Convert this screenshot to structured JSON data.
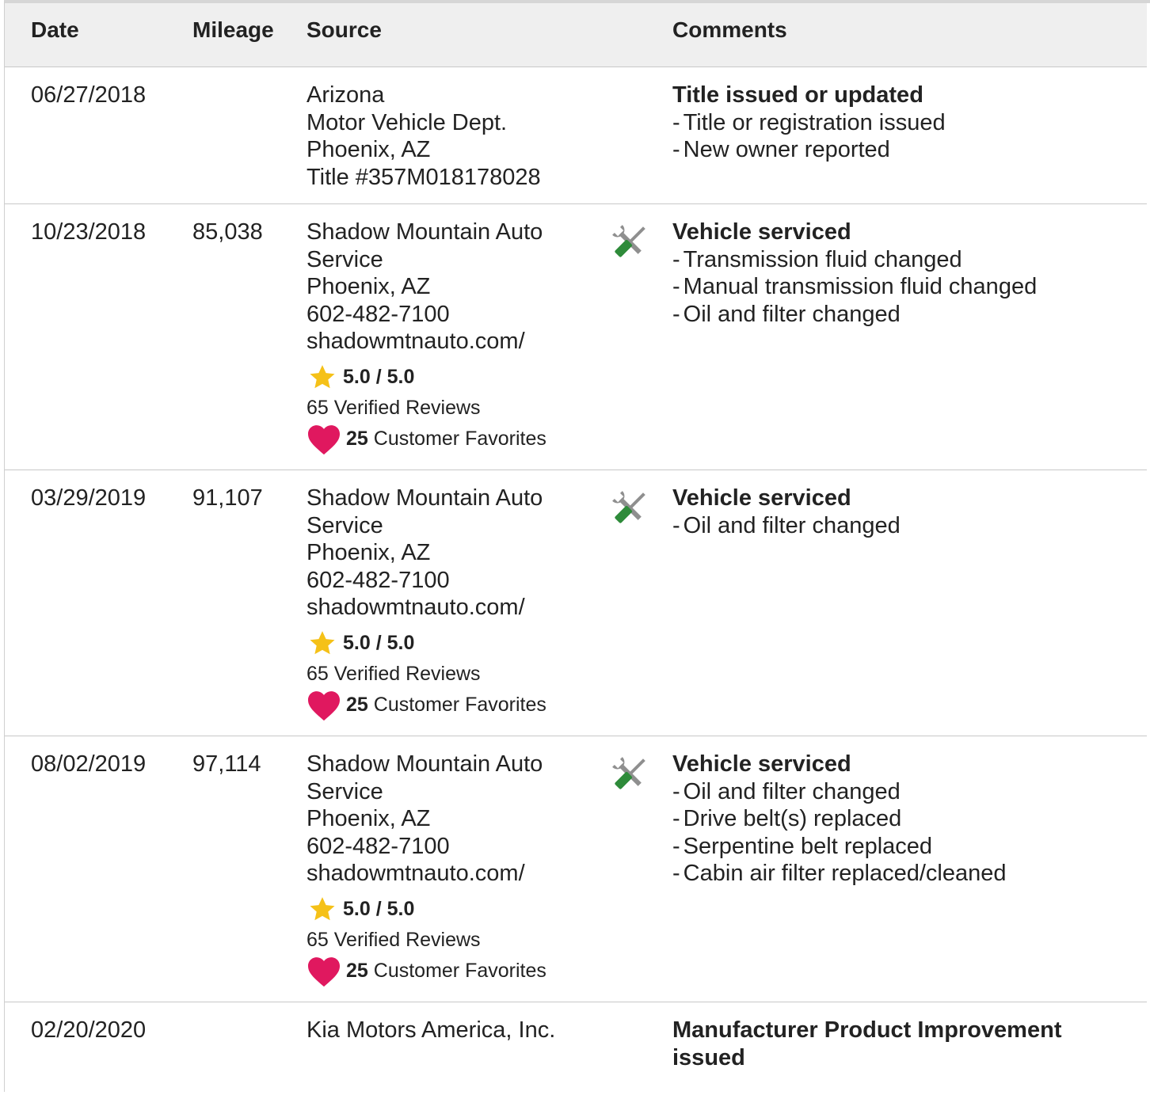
{
  "table": {
    "headers": {
      "date": "Date",
      "mileage": "Mileage",
      "source": "Source",
      "comments": "Comments"
    },
    "rows": [
      {
        "date": "06/27/2018",
        "mileage": "",
        "source_lines": [
          "Arizona",
          "Motor Vehicle Dept.",
          "Phoenix, AZ",
          "Title #357M018178028"
        ],
        "comment_title": "Title issued or updated",
        "comment_items": [
          "Title or registration issued",
          "New owner reported"
        ]
      },
      {
        "date": "10/23/2018",
        "mileage": "85,038",
        "source_lines": [
          "Shadow Mountain Auto",
          "Service",
          "Phoenix, AZ",
          "602-482-7100",
          "shadowmtnauto.com/"
        ],
        "rating": "5.0 / 5.0",
        "reviews": "65 Verified Reviews",
        "favorites_count": "25",
        "favorites_label": "Customer Favorites",
        "service_icon": "wrench-screwdriver-icon",
        "comment_title": "Vehicle serviced",
        "comment_items": [
          "Transmission fluid changed",
          "Manual transmission fluid changed",
          "Oil and filter changed"
        ]
      },
      {
        "date": "03/29/2019",
        "mileage": "91,107",
        "source_lines": [
          "Shadow Mountain Auto",
          "Service",
          "Phoenix, AZ",
          "602-482-7100",
          "shadowmtnauto.com/"
        ],
        "rating": "5.0 / 5.0",
        "reviews": "65 Verified Reviews",
        "favorites_count": "25",
        "favorites_label": "Customer Favorites",
        "service_icon": "wrench-screwdriver-icon",
        "comment_title": "Vehicle serviced",
        "comment_items": [
          "Oil and filter changed"
        ]
      },
      {
        "date": "08/02/2019",
        "mileage": "97,114",
        "source_lines": [
          "Shadow Mountain Auto",
          "Service",
          "Phoenix, AZ",
          "602-482-7100",
          "shadowmtnauto.com/"
        ],
        "rating": "5.0 / 5.0",
        "reviews": "65 Verified Reviews",
        "favorites_count": "25",
        "favorites_label": "Customer Favorites",
        "service_icon": "wrench-screwdriver-icon",
        "comment_title": "Vehicle serviced",
        "comment_items": [
          "Oil and filter changed",
          "Drive belt(s) replaced",
          "Serpentine belt replaced",
          "Cabin air filter replaced/cleaned"
        ]
      },
      {
        "date": "02/20/2020",
        "mileage": "",
        "source_lines": [
          "Kia Motors America, Inc."
        ],
        "comment_title": "Manufacturer Product Improvement issued",
        "comment_items": []
      }
    ]
  },
  "colors": {
    "header_bg": "#efefef",
    "star": "#f5c118",
    "heart": "#e0185f",
    "wrench": "#8f8f8f",
    "screwdriver": "#2e8b3a"
  }
}
